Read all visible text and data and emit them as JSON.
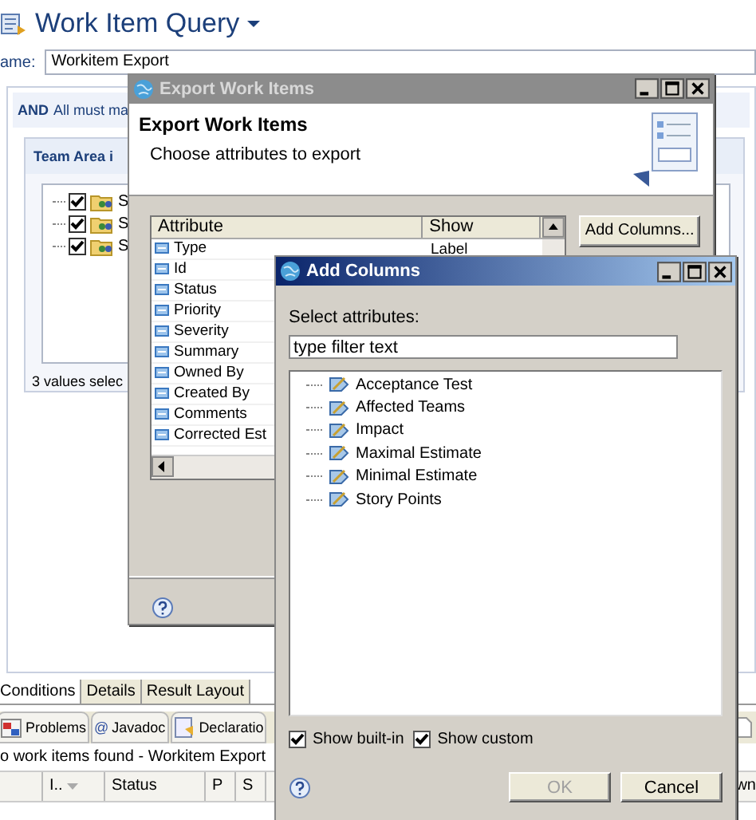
{
  "editor": {
    "title": "Work Item Query",
    "name_label": "ame:",
    "name_value": "Workitem Export",
    "conditions": {
      "operator": "AND",
      "header": "All must ma",
      "team_area": "Team Area i",
      "items": [
        {
          "label": "S",
          "checked": true
        },
        {
          "label": "S",
          "checked": true
        },
        {
          "label": "S",
          "checked": true
        }
      ],
      "count": "3 values selec"
    },
    "tabs": [
      {
        "label": "Conditions",
        "selected": true
      },
      {
        "label": "Details",
        "selected": false
      },
      {
        "label": "Result Layout",
        "selected": false
      }
    ],
    "view_tabs": [
      {
        "kind": "problems",
        "label": "Problems",
        "selected": false
      },
      {
        "kind": "javadoc",
        "glyph": "@",
        "label": "Javadoc",
        "selected": false
      },
      {
        "kind": "declaration",
        "label": "Declaratio",
        "selected": false
      }
    ],
    "status": "o work items found - Workitem Export",
    "columns": [
      "I..",
      "Status",
      "P",
      "S"
    ],
    "edge_text": "wn"
  },
  "export_dialog": {
    "title": "Export Work Items",
    "heading": "Export Work Items",
    "description": "Choose attributes to export",
    "columns": [
      "Attribute",
      "Show"
    ],
    "rows": [
      {
        "attribute": "Type",
        "show": "Label"
      },
      {
        "attribute": "Id"
      },
      {
        "attribute": "Status"
      },
      {
        "attribute": "Priority"
      },
      {
        "attribute": "Severity"
      },
      {
        "attribute": "Summary"
      },
      {
        "attribute": "Owned By"
      },
      {
        "attribute": "Created By"
      },
      {
        "attribute": "Comments"
      },
      {
        "attribute": "Corrected Est"
      }
    ],
    "add_button": "Add Columns..."
  },
  "add_dialog": {
    "title": "Add Columns",
    "prompt": "Select attributes:",
    "filter": "type filter text",
    "items": [
      "Acceptance Test",
      "Affected Teams",
      "Impact",
      "Maximal Estimate",
      "Minimal Estimate",
      "Story Points"
    ],
    "options": [
      {
        "label": "Show built-in",
        "checked": true
      },
      {
        "label": "Show custom",
        "checked": true
      }
    ],
    "buttons": [
      {
        "label": "OK",
        "disabled": true
      },
      {
        "label": "Cancel",
        "disabled": false
      }
    ]
  }
}
